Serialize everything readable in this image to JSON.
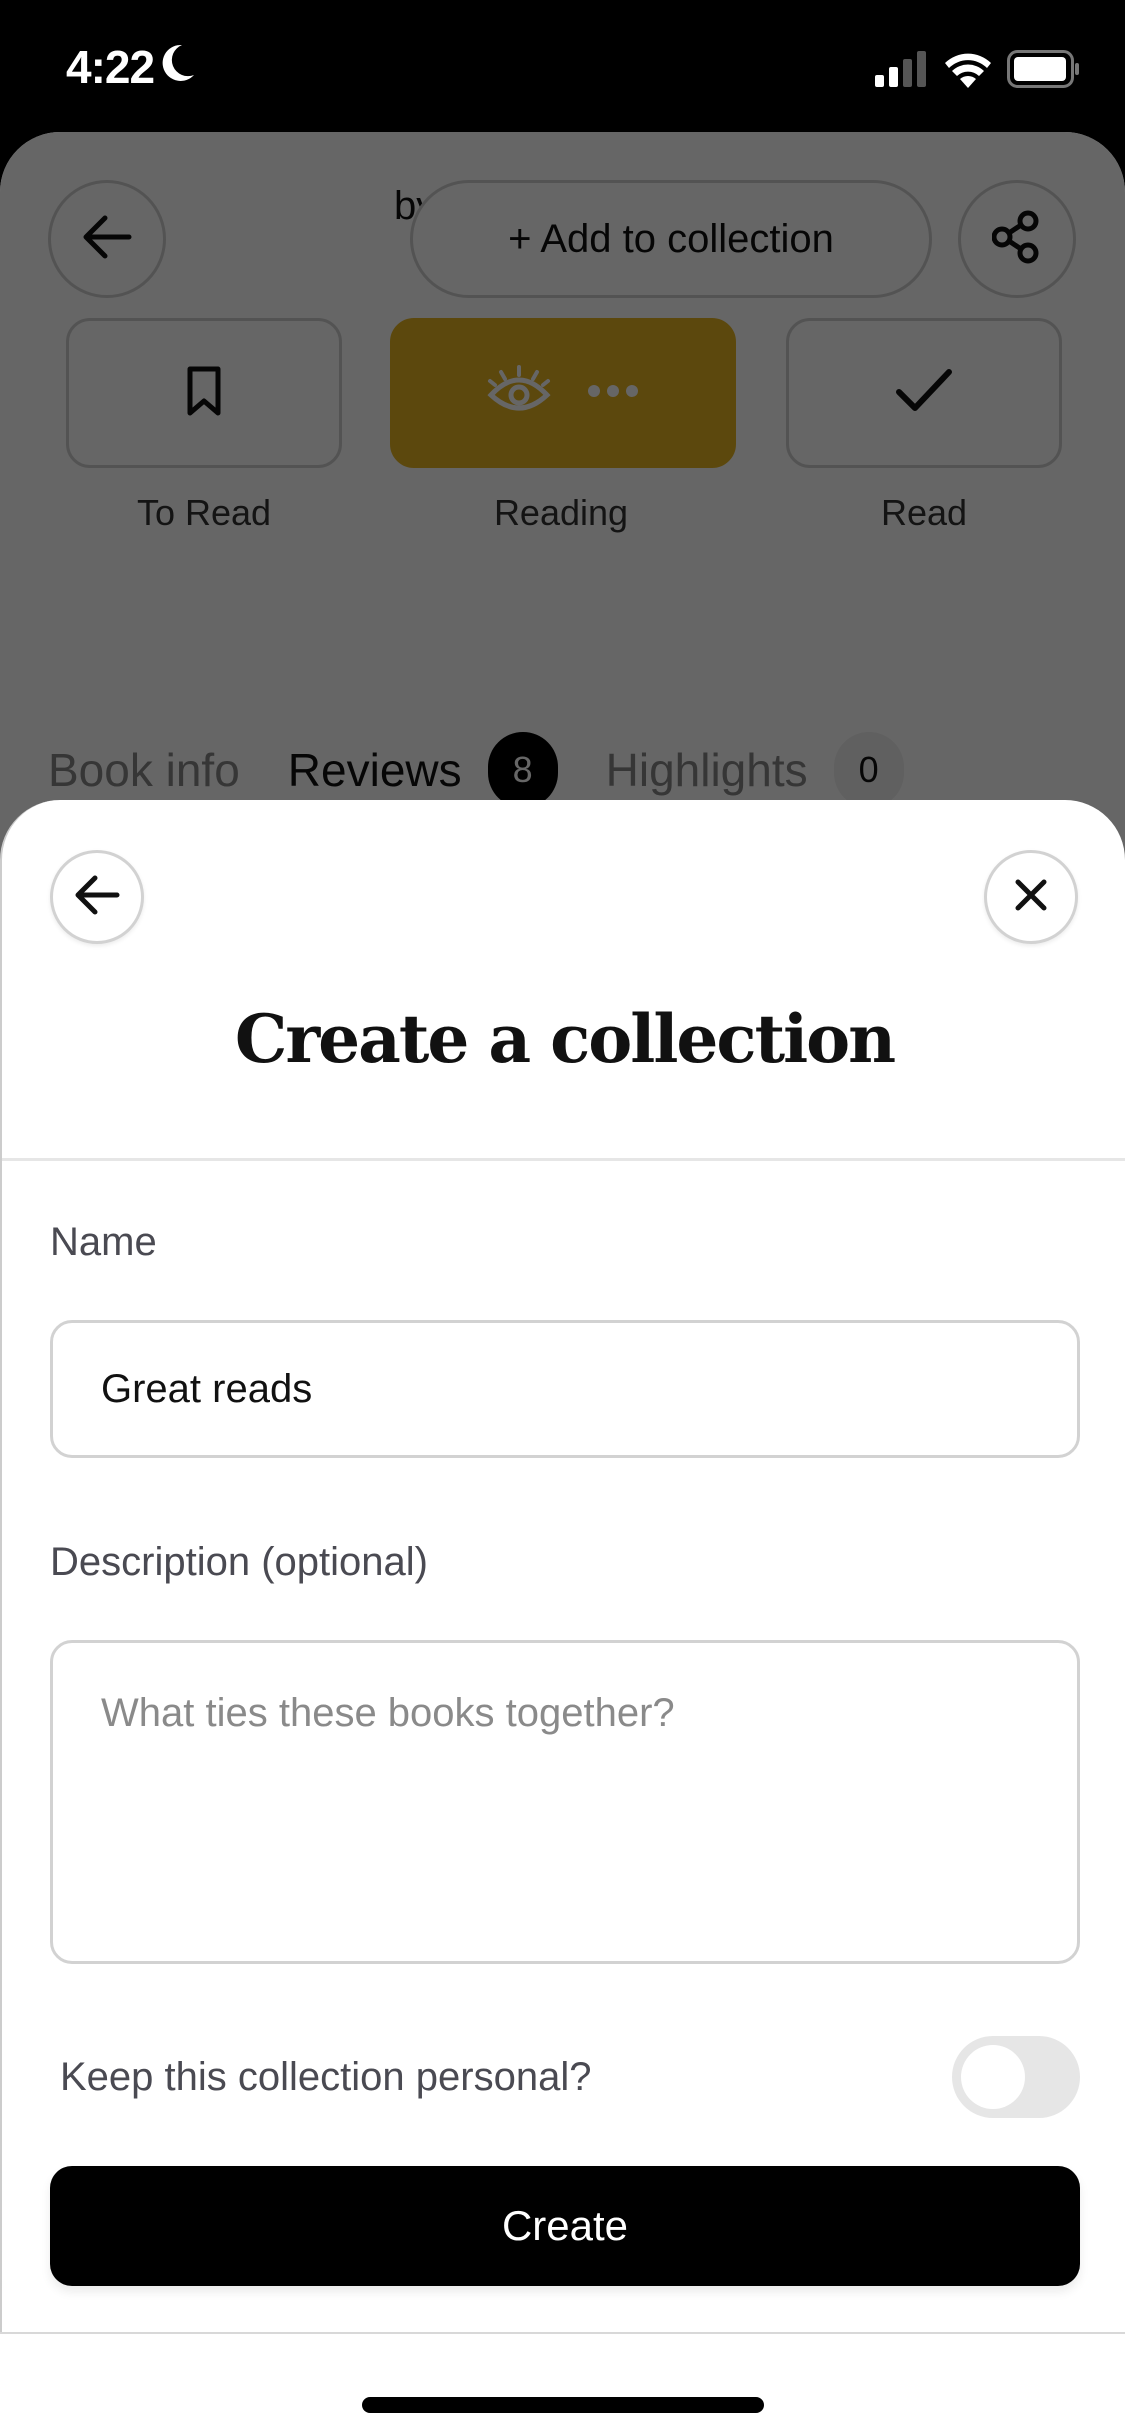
{
  "status_bar": {
    "time": "4:22",
    "focus_icon": "moon-icon",
    "signal_icon": "cellular-signal-icon",
    "wifi_icon": "wifi-icon",
    "battery_icon": "battery-icon"
  },
  "background_page": {
    "byline_fragment": "by",
    "add_to_collection_label": "+ Add to collection",
    "back_icon": "arrow-left-icon",
    "share_icon": "share-icon",
    "reading_status": [
      {
        "label": "To Read",
        "icon": "bookmark-icon",
        "active": false
      },
      {
        "label": "Reading",
        "icon": "eye-icon",
        "active": true
      },
      {
        "label": "Read",
        "icon": "check-icon",
        "active": false
      }
    ],
    "tabs": [
      {
        "label": "Book info",
        "active": false
      },
      {
        "label": "Reviews",
        "badge": "8",
        "active": true
      },
      {
        "label": "Highlights",
        "badge": "0",
        "active": false
      }
    ]
  },
  "sheet": {
    "title": "Create a collection",
    "back_icon": "arrow-left-icon",
    "close_icon": "close-icon",
    "name_label": "Name",
    "name_value": "Great reads",
    "description_label": "Description (optional)",
    "description_placeholder": "What ties these books together?",
    "description_value": "",
    "personal_toggle_label": "Keep this collection personal?",
    "personal_toggle_on": false,
    "create_label": "Create"
  },
  "colors": {
    "reading_active": "#e6b522",
    "primary_button": "#000000",
    "toggle_off": "#e6e6e6"
  }
}
